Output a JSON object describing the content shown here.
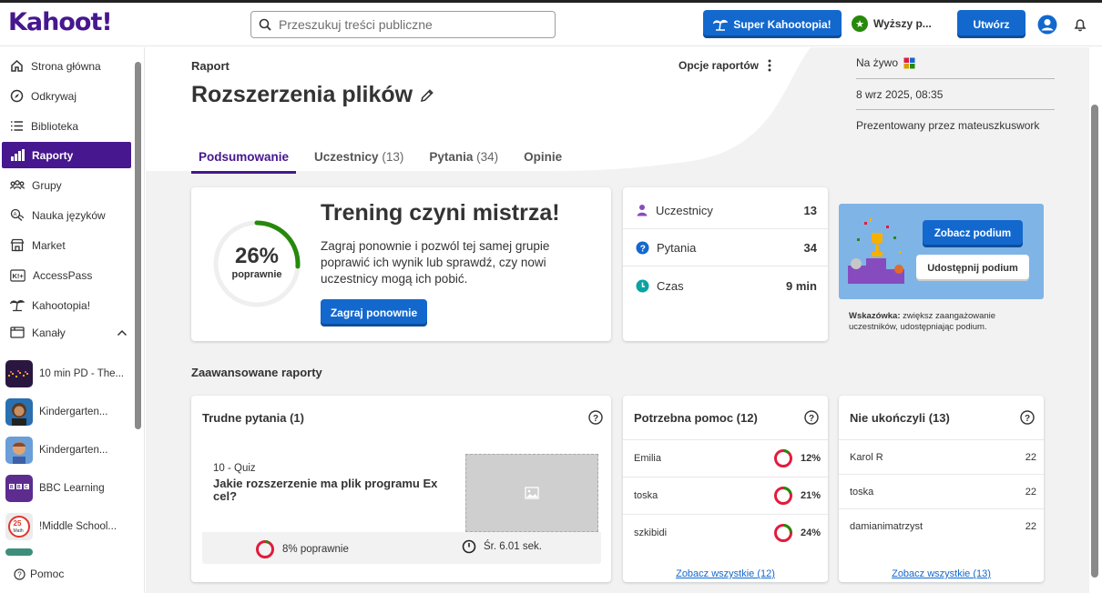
{
  "app": {
    "logo": "Kahoot!",
    "search_placeholder": "Przeszukuj treści publiczne",
    "super_label": "Super Kahootopia!",
    "upgrade_label": "Wyższy p...",
    "create_label": "Utwórz"
  },
  "sidebar": {
    "items": [
      {
        "label": "Strona główna",
        "icon": "home-icon"
      },
      {
        "label": "Odkrywaj",
        "icon": "compass-icon"
      },
      {
        "label": "Biblioteka",
        "icon": "list-icon"
      },
      {
        "label": "Raporty",
        "icon": "bar-chart-icon"
      },
      {
        "label": "Grupy",
        "icon": "group-icon"
      },
      {
        "label": "Nauka języków",
        "icon": "language-icon"
      },
      {
        "label": "Market",
        "icon": "store-icon"
      },
      {
        "label": "AccessPass",
        "icon": "accesspass-icon"
      },
      {
        "label": "Kahootopia!",
        "icon": "kahootopia-icon"
      },
      {
        "label": "Kanały",
        "icon": "channels-icon"
      }
    ],
    "channels": [
      {
        "label": "10 min PD - The..."
      },
      {
        "label": "Kindergarten..."
      },
      {
        "label": "Kindergarten..."
      },
      {
        "label": "BBC Learning"
      },
      {
        "label": "!Middle School..."
      }
    ],
    "help": "Pomoc"
  },
  "report": {
    "label": "Raport",
    "title": "Rozszerzenia plików",
    "options_label": "Opcje raportów",
    "mode": "Na żywo",
    "date": "8 wrz 2025, 08:35",
    "presented_by": "Prezentowany przez mateuszkuswork"
  },
  "tabs": [
    {
      "label": "Podsumowanie",
      "count": ""
    },
    {
      "label": "Uczestnicy",
      "count": "(13)"
    },
    {
      "label": "Pytania",
      "count": "(34)"
    },
    {
      "label": "Opinie",
      "count": ""
    }
  ],
  "summary": {
    "percent": "26%",
    "percent_value": 26,
    "percent_label": "poprawnie",
    "heading": "Trening czyni mistrza!",
    "text": "Zagraj ponownie i pozwól tej samej grupie poprawić ich wynik lub sprawdź, czy nowi uczestnicy mogą ich pobić.",
    "replay_label": "Zagraj ponownie"
  },
  "stats": [
    {
      "label": "Uczestnicy",
      "value": "13"
    },
    {
      "label": "Pytania",
      "value": "34"
    },
    {
      "label": "Czas",
      "value": "9 min"
    }
  ],
  "podium": {
    "see_label": "Zobacz podium",
    "share_label": "Udostępnij podium",
    "tip_bold": "Wskazówka:",
    "tip_text": " zwiększ zaangażowanie uczestników, udostępniając podium."
  },
  "advanced": {
    "title": "Zaawansowane raporty",
    "hard": {
      "title": "Trudne pytania (1)",
      "meta": "10 - Quiz",
      "question": "Jakie rozszerzenie ma plik programu Ex cel?",
      "correct": "8% poprawnie",
      "correct_value": 8,
      "avg_time": "Śr. 6.01 sek."
    },
    "help_needed": {
      "title": "Potrzebna pomoc (12)",
      "rows": [
        {
          "name": "Emilia",
          "value": "12%",
          "pct": 12
        },
        {
          "name": "toska",
          "value": "21%",
          "pct": 21
        },
        {
          "name": "szkibidi",
          "value": "24%",
          "pct": 24
        }
      ],
      "link": "Zobacz wszystkie (12)"
    },
    "not_finished": {
      "title": "Nie ukończyli (13)",
      "rows": [
        {
          "name": "Karol R",
          "value": "22"
        },
        {
          "name": "toska",
          "value": "22"
        },
        {
          "name": "damianimatrzyst",
          "value": "22"
        }
      ],
      "link": "Zobacz wszystkie (13)"
    }
  },
  "colors": {
    "brand": "#46178f",
    "primary_button": "#1368ce",
    "progress_green": "#26890c",
    "low_score_red": "#e21b3c"
  }
}
